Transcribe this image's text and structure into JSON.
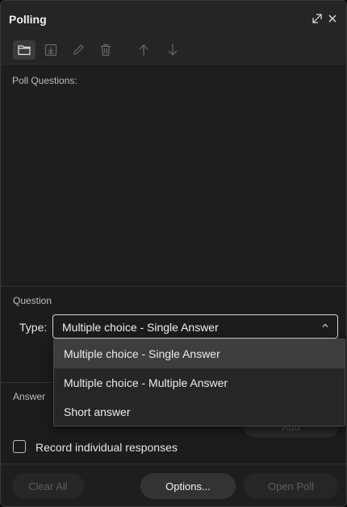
{
  "window": {
    "title": "Polling",
    "restore_icon": "restore-icon",
    "close_icon": "close-icon"
  },
  "toolbar": {
    "buttons": [
      {
        "icon": "folder-icon",
        "active": true
      },
      {
        "icon": "import-icon",
        "active": false
      },
      {
        "icon": "edit-icon",
        "active": false
      },
      {
        "icon": "trash-icon",
        "active": false
      },
      {
        "icon": "arrow-up-icon",
        "active": false
      },
      {
        "icon": "arrow-down-icon",
        "active": false
      }
    ]
  },
  "questions": {
    "label": "Poll Questions:"
  },
  "question": {
    "section_label": "Question",
    "type_label": "Type:",
    "type_value": "Multiple choice - Single Answer",
    "type_options": [
      "Multiple choice - Single Answer",
      "Multiple choice - Multiple Answer",
      "Short answer"
    ],
    "selected_index": 0
  },
  "answer": {
    "section_label": "Answer",
    "add_label": "Add"
  },
  "record": {
    "label": "Record individual responses",
    "checked": false
  },
  "footer": {
    "clear_all": "Clear All",
    "options": "Options...",
    "open_poll": "Open Poll"
  },
  "colors": {
    "background": "#1c1c1c",
    "header": "#252525",
    "text": "#e6e6e6",
    "disabled_text": "#5e5e5e",
    "selected_option": "#3e3e3e"
  }
}
